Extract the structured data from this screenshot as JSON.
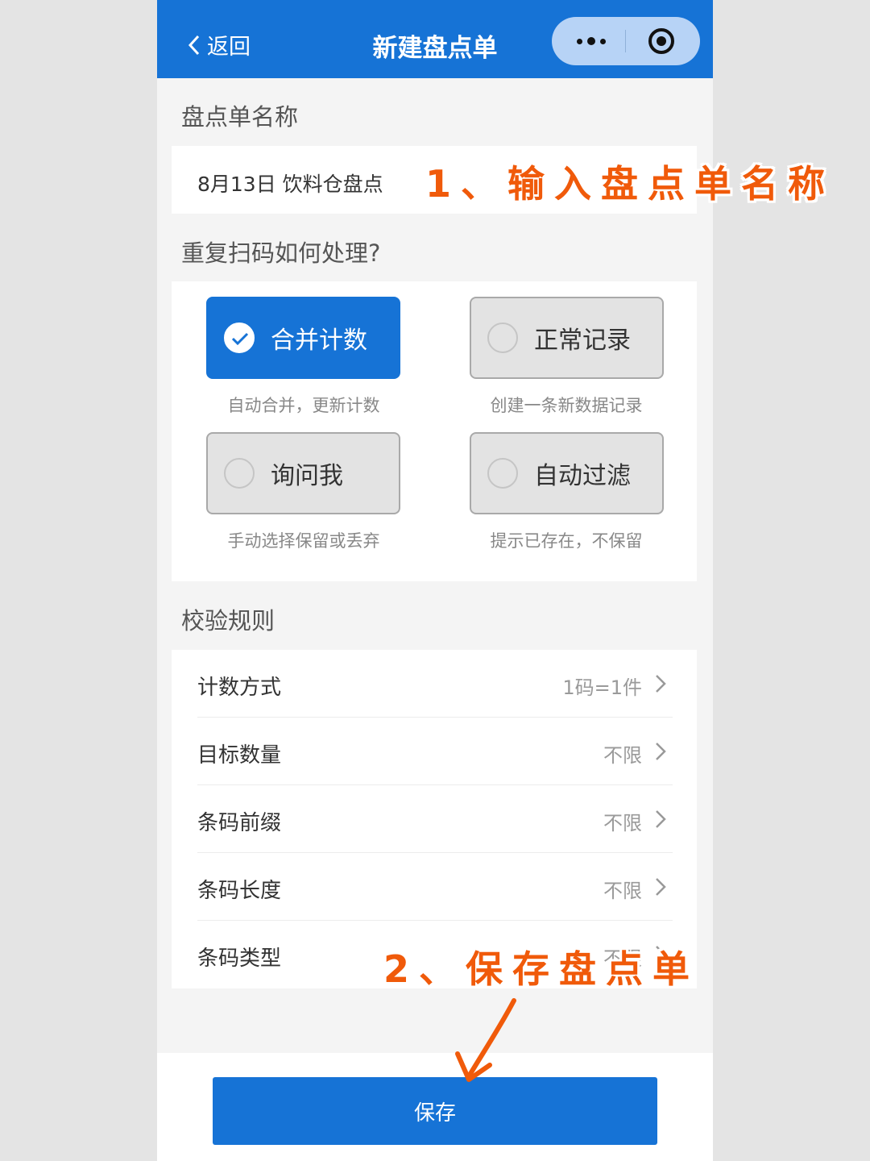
{
  "header": {
    "back_label": "返回",
    "title": "新建盘点单",
    "capsule": {
      "more_icon": "more-dots-icon",
      "close_icon": "close-target-icon"
    }
  },
  "name_section": {
    "label": "盘点单名称",
    "value": "8月13日 饮料仓盘点"
  },
  "duplicate_section": {
    "label": "重复扫码如何处理?",
    "options": [
      {
        "label": "合并计数",
        "desc": "自动合并，更新计数",
        "selected": true
      },
      {
        "label": "正常记录",
        "desc": "创建一条新数据记录",
        "selected": false
      },
      {
        "label": "询问我",
        "desc": "手动选择保留或丢弃",
        "selected": false
      },
      {
        "label": "自动过滤",
        "desc": "提示已存在，不保留",
        "selected": false
      }
    ]
  },
  "rules_section": {
    "label": "校验规则",
    "rows": [
      {
        "label": "计数方式",
        "value": "1码=1件"
      },
      {
        "label": "目标数量",
        "value": "不限"
      },
      {
        "label": "条码前缀",
        "value": "不限"
      },
      {
        "label": "条码长度",
        "value": "不限"
      },
      {
        "label": "条码类型",
        "value": "不限"
      }
    ]
  },
  "save_button": {
    "label": "保存"
  },
  "annotations": {
    "step1": "1、输入盘点单名称",
    "step2": "2、保存盘点单"
  },
  "colors": {
    "primary": "#1673d6",
    "annotation": "#f05a0a",
    "page_bg": "#f4f4f4"
  }
}
